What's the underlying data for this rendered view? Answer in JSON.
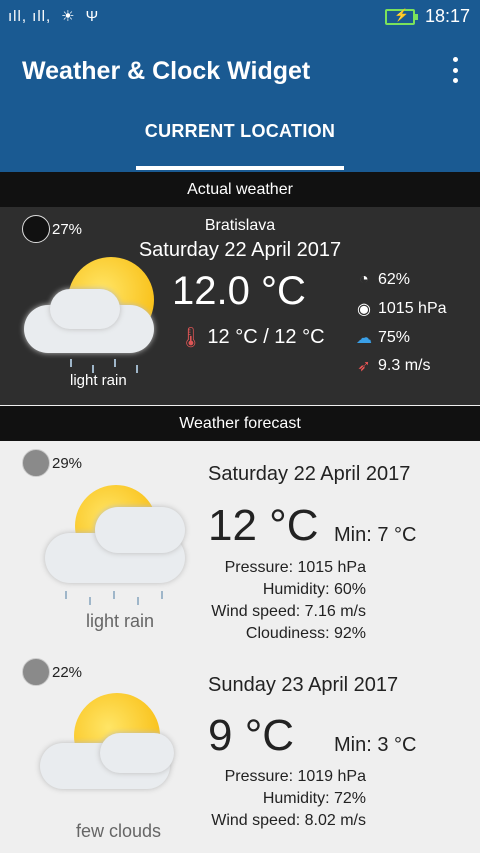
{
  "status_bar": {
    "signal": "ıll, ıll,",
    "time": "18:17"
  },
  "app_bar": {
    "title": "Weather & Clock Widget",
    "tab": "CURRENT LOCATION"
  },
  "actual": {
    "header": "Actual weather",
    "moon_pct": "27%",
    "city": "Bratislava",
    "date": "Saturday 22 April 2017",
    "temp": "12.0 °C",
    "min_max": "12 °C / 12 °C",
    "condition": "light rain",
    "humidity": "62%",
    "pressure": "1015 hPa",
    "cloudiness": "75%",
    "wind": "9.3 m/s"
  },
  "forecast": {
    "header": "Weather forecast",
    "days": [
      {
        "moon_pct": "29%",
        "date": "Saturday 22 April 2017",
        "temp": "12 °C",
        "min": "Min: 7 °C",
        "pressure_label": "Pressure:",
        "pressure": "1015 hPa",
        "humidity_label": "Humidity:",
        "humidity": "60%",
        "wind_label": "Wind speed:",
        "wind": "7.16 m/s",
        "cloud_label": "Cloudiness:",
        "cloud": "92%",
        "condition": "light rain"
      },
      {
        "moon_pct": "22%",
        "date": "Sunday 23 April 2017",
        "temp": "9 °C",
        "min": "Min: 3 °C",
        "pressure_label": "Pressure:",
        "pressure": "1019 hPa",
        "humidity_label": "Humidity:",
        "humidity": "72%",
        "wind_label": "Wind speed:",
        "wind": "8.02 m/s",
        "condition": "few clouds"
      }
    ]
  }
}
